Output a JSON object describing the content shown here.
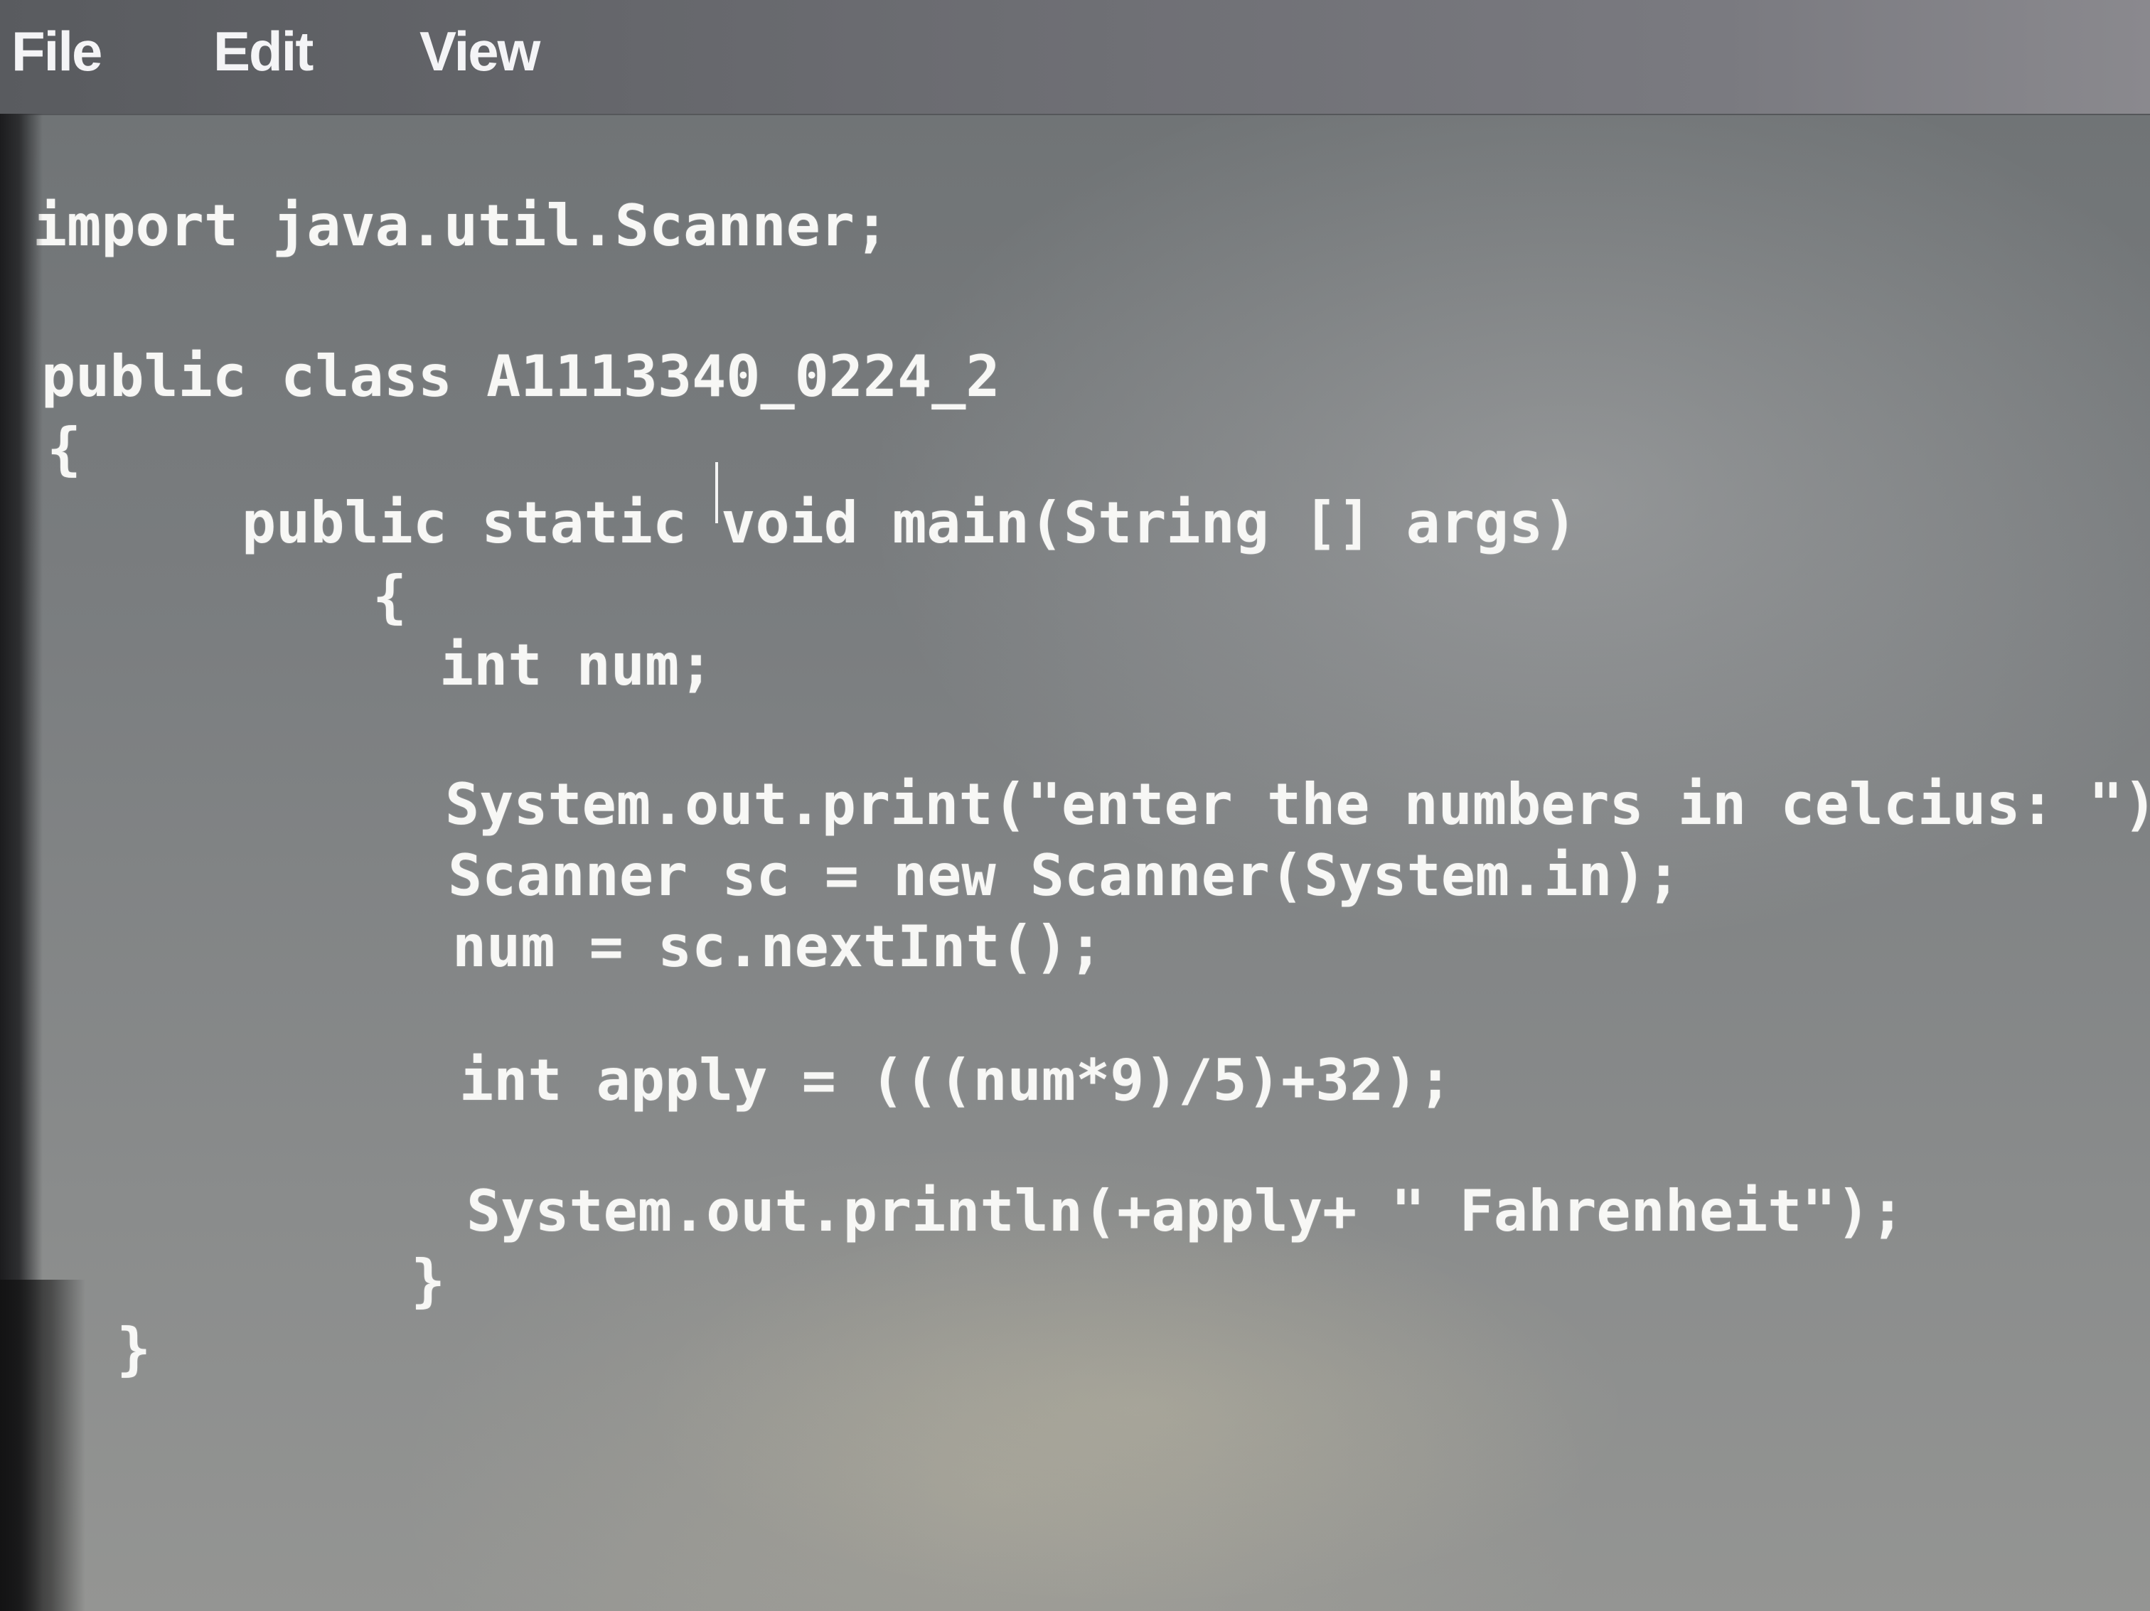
{
  "menubar": {
    "items": [
      {
        "label": "File"
      },
      {
        "label": "Edit"
      },
      {
        "label": "View"
      }
    ]
  },
  "editor": {
    "lines": [
      "import java.util.Scanner;",
      "public class A1113340_0224_2",
      "{",
      "public static void main(String [] args)",
      "{",
      "int num;",
      "System.out.print(\"enter the numbers in celcius: \");",
      "Scanner sc = new Scanner(System.in);",
      "num = sc.nextInt();",
      "int apply = (((num*9)/5)+32);",
      "System.out.println(+apply+ \" Fahrenheit\");",
      "}",
      "}"
    ]
  },
  "colors": {
    "menubar_bg": "#6a6b70",
    "editor_bg": "#7b7e80",
    "text": "#f7f7f5"
  }
}
